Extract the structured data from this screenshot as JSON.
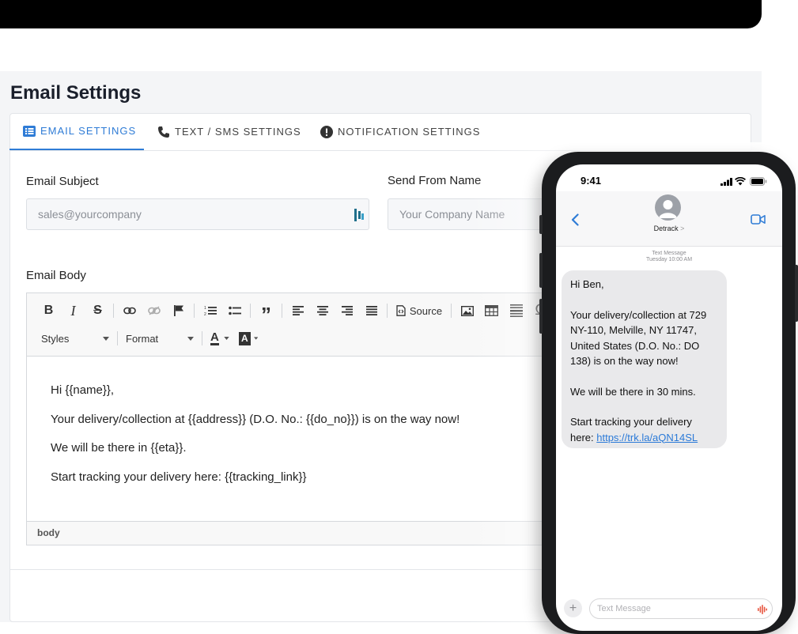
{
  "page": {
    "title": "Email Settings"
  },
  "tabs": [
    {
      "label": "EMAIL SETTINGS",
      "icon": "list-icon",
      "active": true
    },
    {
      "label": "TEXT / SMS SETTINGS",
      "icon": "phone-icon",
      "active": false
    },
    {
      "label": "NOTIFICATION SETTINGS",
      "icon": "alert-icon",
      "active": false
    }
  ],
  "form": {
    "subject_label": "Email Subject",
    "subject_placeholder": "sales@yourcompany",
    "from_label": "Send From Name",
    "from_placeholder": "Your Company Name",
    "body_label": "Email Body"
  },
  "editor": {
    "toolbar": {
      "bold": "B",
      "italic": "I",
      "strike": "S",
      "quote": "”",
      "source_label": "Source",
      "special_char": "Ω",
      "styles_label": "Styles",
      "format_label": "Format",
      "text_color": "A",
      "bg_color": "A"
    },
    "content": [
      "Hi {{name}},",
      "Your delivery/collection at {{address}} (D.O. No.: {{do_no}}) is on the way now!",
      "We will be there in {{eta}}.",
      "Start tracking your delivery here: {{tracking_link}}"
    ],
    "status_path": "body"
  },
  "phone": {
    "time": "9:41",
    "contact_name": "Detrack",
    "contact_chevron": ">",
    "message_type": "Text Message",
    "message_time": "Tuesday 10:00 AM",
    "message_paragraphs": [
      "Hi Ben,",
      "Your delivery/collection at 729 NY-110, Melville, NY 11747, United States (D.O. No.: DO 138) is on the way now!",
      "We will be there in 30 mins."
    ],
    "message_tracking_text": "Start tracking your delivery here: ",
    "message_link": "https://trk.la/aQN14SL",
    "composer_placeholder": "Text Message",
    "plus": "+"
  },
  "colors": {
    "accent": "#2f7cd6",
    "link": "#2b7ad8",
    "bubble": "#e9e9eb"
  }
}
